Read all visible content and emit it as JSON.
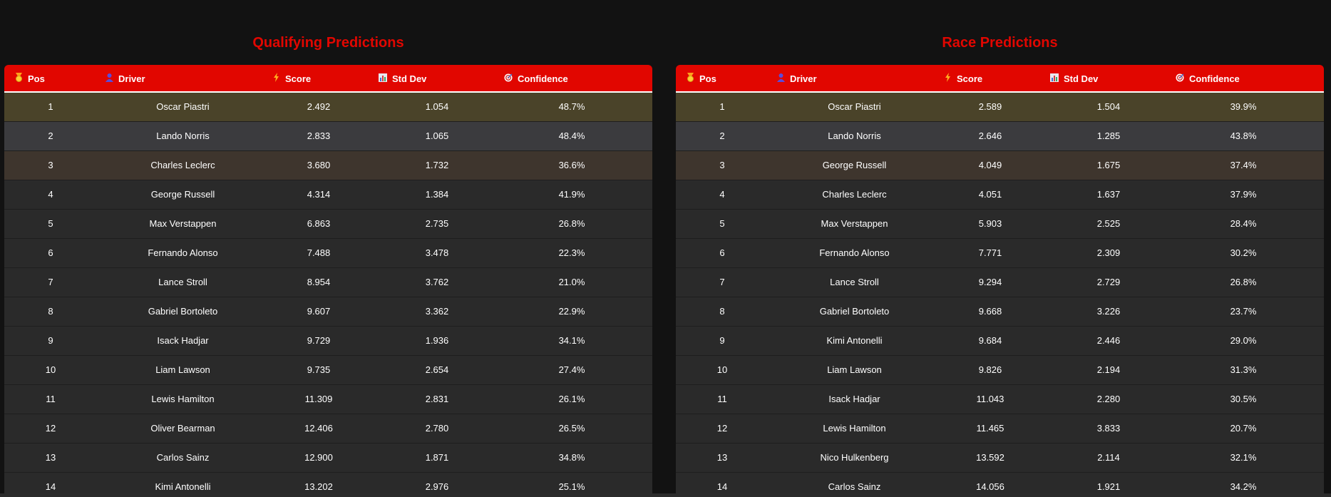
{
  "qualifying": {
    "title": "Qualifying Predictions",
    "headers": {
      "pos": "Pos",
      "driver": "Driver",
      "score": "Score",
      "std": "Std Dev",
      "conf": "Confidence"
    },
    "rows": [
      {
        "pos": "1",
        "driver": "Oscar Piastri",
        "score": "2.492",
        "std": "1.054",
        "conf": "48.7%"
      },
      {
        "pos": "2",
        "driver": "Lando Norris",
        "score": "2.833",
        "std": "1.065",
        "conf": "48.4%"
      },
      {
        "pos": "3",
        "driver": "Charles Leclerc",
        "score": "3.680",
        "std": "1.732",
        "conf": "36.6%"
      },
      {
        "pos": "4",
        "driver": "George Russell",
        "score": "4.314",
        "std": "1.384",
        "conf": "41.9%"
      },
      {
        "pos": "5",
        "driver": "Max Verstappen",
        "score": "6.863",
        "std": "2.735",
        "conf": "26.8%"
      },
      {
        "pos": "6",
        "driver": "Fernando Alonso",
        "score": "7.488",
        "std": "3.478",
        "conf": "22.3%"
      },
      {
        "pos": "7",
        "driver": "Lance Stroll",
        "score": "8.954",
        "std": "3.762",
        "conf": "21.0%"
      },
      {
        "pos": "8",
        "driver": "Gabriel Bortoleto",
        "score": "9.607",
        "std": "3.362",
        "conf": "22.9%"
      },
      {
        "pos": "9",
        "driver": "Isack Hadjar",
        "score": "9.729",
        "std": "1.936",
        "conf": "34.1%"
      },
      {
        "pos": "10",
        "driver": "Liam Lawson",
        "score": "9.735",
        "std": "2.654",
        "conf": "27.4%"
      },
      {
        "pos": "11",
        "driver": "Lewis Hamilton",
        "score": "11.309",
        "std": "2.831",
        "conf": "26.1%"
      },
      {
        "pos": "12",
        "driver": "Oliver Bearman",
        "score": "12.406",
        "std": "2.780",
        "conf": "26.5%"
      },
      {
        "pos": "13",
        "driver": "Carlos Sainz",
        "score": "12.900",
        "std": "1.871",
        "conf": "34.8%"
      },
      {
        "pos": "14",
        "driver": "Kimi Antonelli",
        "score": "13.202",
        "std": "2.976",
        "conf": "25.1%"
      }
    ]
  },
  "race": {
    "title": "Race Predictions",
    "headers": {
      "pos": "Pos",
      "driver": "Driver",
      "score": "Score",
      "std": "Std Dev",
      "conf": "Confidence"
    },
    "rows": [
      {
        "pos": "1",
        "driver": "Oscar Piastri",
        "score": "2.589",
        "std": "1.504",
        "conf": "39.9%"
      },
      {
        "pos": "2",
        "driver": "Lando Norris",
        "score": "2.646",
        "std": "1.285",
        "conf": "43.8%"
      },
      {
        "pos": "3",
        "driver": "George Russell",
        "score": "4.049",
        "std": "1.675",
        "conf": "37.4%"
      },
      {
        "pos": "4",
        "driver": "Charles Leclerc",
        "score": "4.051",
        "std": "1.637",
        "conf": "37.9%"
      },
      {
        "pos": "5",
        "driver": "Max Verstappen",
        "score": "5.903",
        "std": "2.525",
        "conf": "28.4%"
      },
      {
        "pos": "6",
        "driver": "Fernando Alonso",
        "score": "7.771",
        "std": "2.309",
        "conf": "30.2%"
      },
      {
        "pos": "7",
        "driver": "Lance Stroll",
        "score": "9.294",
        "std": "2.729",
        "conf": "26.8%"
      },
      {
        "pos": "8",
        "driver": "Gabriel Bortoleto",
        "score": "9.668",
        "std": "3.226",
        "conf": "23.7%"
      },
      {
        "pos": "9",
        "driver": "Kimi Antonelli",
        "score": "9.684",
        "std": "2.446",
        "conf": "29.0%"
      },
      {
        "pos": "10",
        "driver": "Liam Lawson",
        "score": "9.826",
        "std": "2.194",
        "conf": "31.3%"
      },
      {
        "pos": "11",
        "driver": "Isack Hadjar",
        "score": "11.043",
        "std": "2.280",
        "conf": "30.5%"
      },
      {
        "pos": "12",
        "driver": "Lewis Hamilton",
        "score": "11.465",
        "std": "3.833",
        "conf": "20.7%"
      },
      {
        "pos": "13",
        "driver": "Nico Hulkenberg",
        "score": "13.592",
        "std": "2.114",
        "conf": "32.1%"
      },
      {
        "pos": "14",
        "driver": "Carlos Sainz",
        "score": "14.056",
        "std": "1.921",
        "conf": "34.2%"
      }
    ]
  },
  "icons": {
    "pos": "medal-icon",
    "driver": "person-icon",
    "score": "lightning-icon",
    "std": "bar-chart-icon",
    "conf": "target-icon"
  },
  "colors": {
    "accent": "#e10600",
    "background": "#121212",
    "row": "#2a2a2a",
    "gold_row": "#4a4329",
    "silver_row": "#3b3b3e",
    "bronze_row": "#3e352d"
  }
}
